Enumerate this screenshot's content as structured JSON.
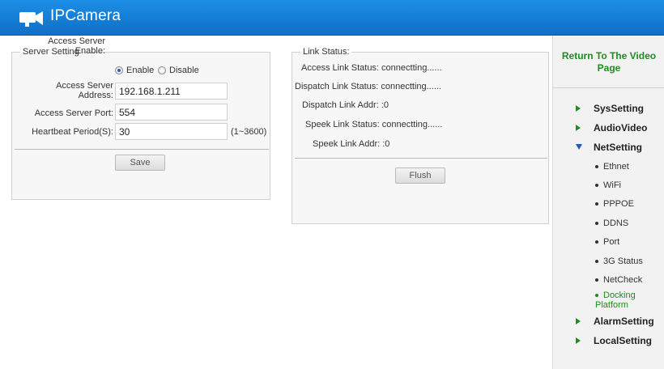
{
  "app": {
    "title": "IPCamera"
  },
  "server_setting": {
    "legend": "Server Setting",
    "access_enable_label": "Access Server Enable:",
    "enable_label": "Enable",
    "disable_label": "Disable",
    "enabled": true,
    "access_address_label": "Access Server Address:",
    "access_address_value": "192.168.1.211",
    "access_port_label": "Access Server Port:",
    "access_port_value": "554",
    "heartbeat_label": "Heartbeat Period(S):",
    "heartbeat_value": "30",
    "heartbeat_range": "(1~3600)",
    "save_label": "Save"
  },
  "link_status": {
    "legend": "Link Status:",
    "lines": [
      "Access Link Status: connectting......",
      "Dispatch Link Status: connectting......",
      "Dispatch Link Addr: :0",
      "Speek Link Status: connectting......",
      "Speek Link Addr: :0"
    ],
    "flush_label": "Flush"
  },
  "sidebar": {
    "return_link": "Return To The Video Page",
    "menu": [
      {
        "label": "SysSetting",
        "expanded": false
      },
      {
        "label": "AudioVideo",
        "expanded": false
      },
      {
        "label": "NetSetting",
        "expanded": true
      },
      {
        "label": "AlarmSetting",
        "expanded": false
      },
      {
        "label": "LocalSetting",
        "expanded": false
      }
    ],
    "net_submenu": [
      {
        "label": "Ethnet",
        "active": false
      },
      {
        "label": "WiFi",
        "active": false
      },
      {
        "label": "PPPOE",
        "active": false
      },
      {
        "label": "DDNS",
        "active": false
      },
      {
        "label": "Port",
        "active": false
      },
      {
        "label": "3G Status",
        "active": false
      },
      {
        "label": "NetCheck",
        "active": false
      },
      {
        "label": "Docking Platform",
        "active": true
      }
    ]
  },
  "colors": {
    "header": "#1878d6",
    "accent_green": "#1e8c1e"
  }
}
